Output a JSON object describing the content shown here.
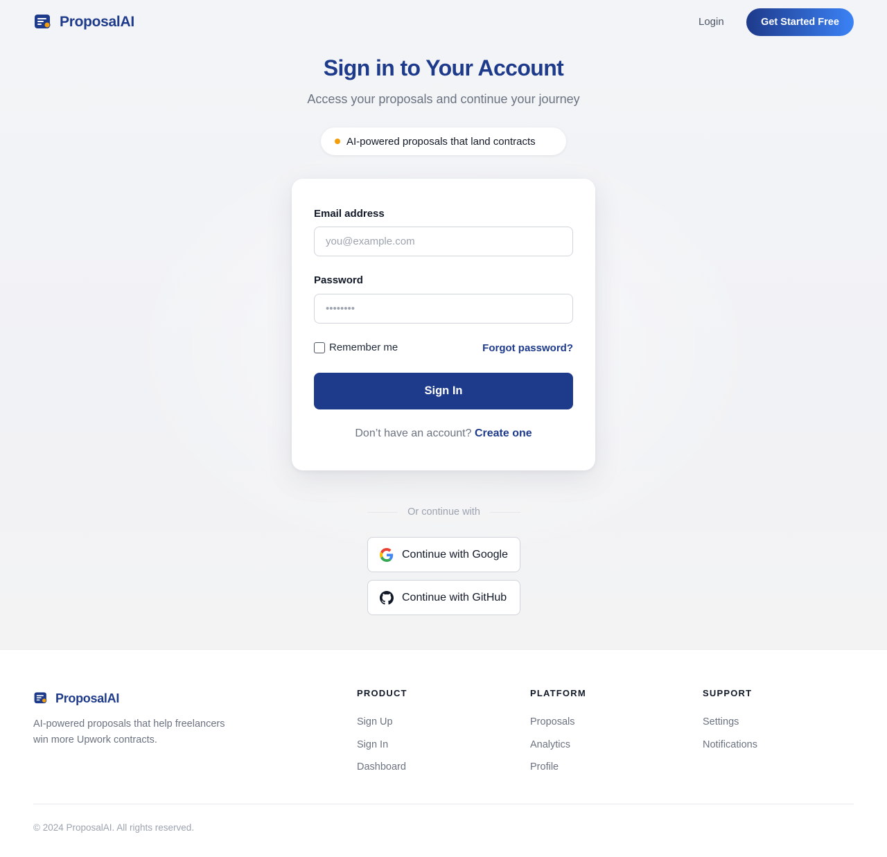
{
  "nav": {
    "brand": "ProposalAI",
    "login": "Login",
    "cta": "Get Started Free"
  },
  "hero": {
    "title": "Sign in to Your Account",
    "subtitle": "Access your proposals and continue your journey",
    "badge": "AI-powered proposals that land contracts"
  },
  "form": {
    "email_label": "Email address",
    "email_placeholder": "you@example.com",
    "email_value": "",
    "password_label": "Password",
    "password_placeholder": "••••••••",
    "password_value": "",
    "remember_label": "Remember me",
    "remember_checked": false,
    "forgot": "Forgot password?",
    "submit": "Sign In",
    "no_account": "Don’t have an account?",
    "create": "Create one"
  },
  "oauth": {
    "divider": "Or continue with",
    "google": "Continue with Google",
    "github": "Continue with GitHub"
  },
  "footer": {
    "brand": "ProposalAI",
    "description": "AI-powered proposals that help freelancers win more Upwork contracts.",
    "columns": [
      {
        "heading": "PRODUCT",
        "links": [
          "Sign Up",
          "Sign In",
          "Dashboard"
        ]
      },
      {
        "heading": "PLATFORM",
        "links": [
          "Proposals",
          "Analytics",
          "Profile"
        ]
      },
      {
        "heading": "SUPPORT",
        "links": [
          "Settings",
          "Notifications"
        ]
      }
    ],
    "copyright": "© 2024 ProposalAI. All rights reserved."
  },
  "colors": {
    "brand": "#1e3a8a",
    "accent_gradient_end": "#3b82f6",
    "badge_dot": "#f59e0b"
  },
  "icons": {
    "logo": "document-lines-icon",
    "google": "google-icon",
    "github": "github-icon"
  }
}
